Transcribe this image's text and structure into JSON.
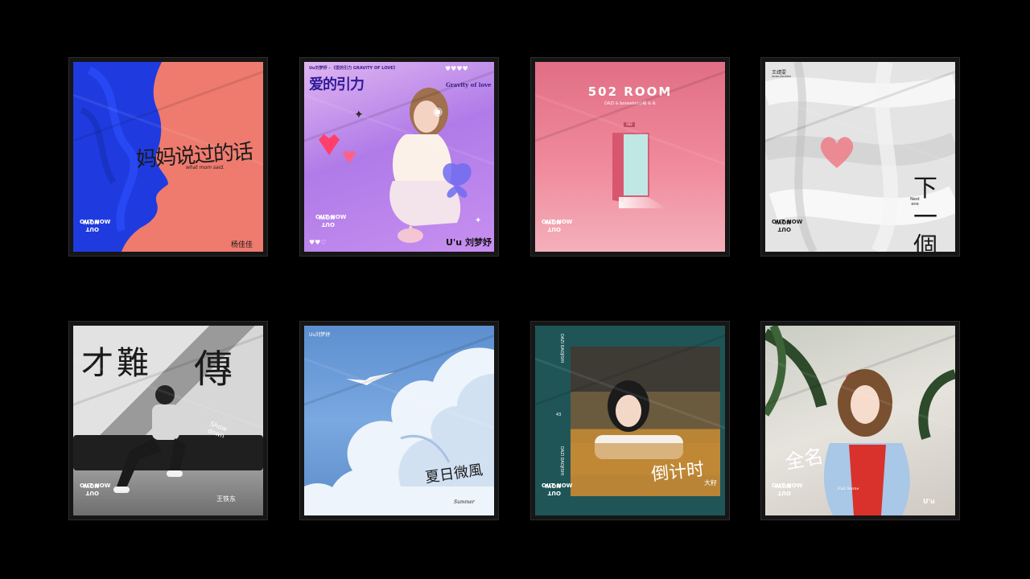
{
  "covers": [
    {
      "title": "妈妈说过的话",
      "subtitle": "what mom said.",
      "artist": "杨佳佳",
      "badge": "OUT NOW"
    },
    {
      "header": "Uu刘梦妤 - 《爱的引力 GRAVITY OF LOVE》",
      "title": "爱的引力",
      "subtitle": "Gravity of love",
      "artist_mark": "U'u",
      "artist": "刘梦妤",
      "badge": "OUT NOW"
    },
    {
      "title": "502 ROOM",
      "credits": "DAZI & bonesbet小鳄 & ik",
      "room_number": "502",
      "badge": "OUT NOW"
    },
    {
      "artist": "王靖雯",
      "artist_en": "WANG JINGWEN",
      "title": "下一個",
      "subtitle": "Next one",
      "badge": "OUT NOW"
    },
    {
      "title_part1": "才難",
      "title_part2": "傳",
      "subtitle": "Show down",
      "artist": "王铁东",
      "badge": "OUT NOW"
    },
    {
      "header": "Uu刘梦妤",
      "title": "夏日微風",
      "subtitle": "Summer"
    },
    {
      "side_text": "DAZI DAOJISHI",
      "side_num": "43",
      "side_text2": "DAZI DAOJISHI",
      "title": "倒计时",
      "artist": "大籽",
      "badge": "OUT NOW"
    },
    {
      "title": "全名",
      "subtitle": "Full Name",
      "artist_mark": "U'u",
      "badge": "OUT NOW"
    }
  ],
  "colors": {
    "background": "#000000",
    "c1_red": "#ee7b6e",
    "c1_blue": "#1f3be0",
    "c3_pink": "#e16f86",
    "c7_teal": "#1f5556"
  }
}
